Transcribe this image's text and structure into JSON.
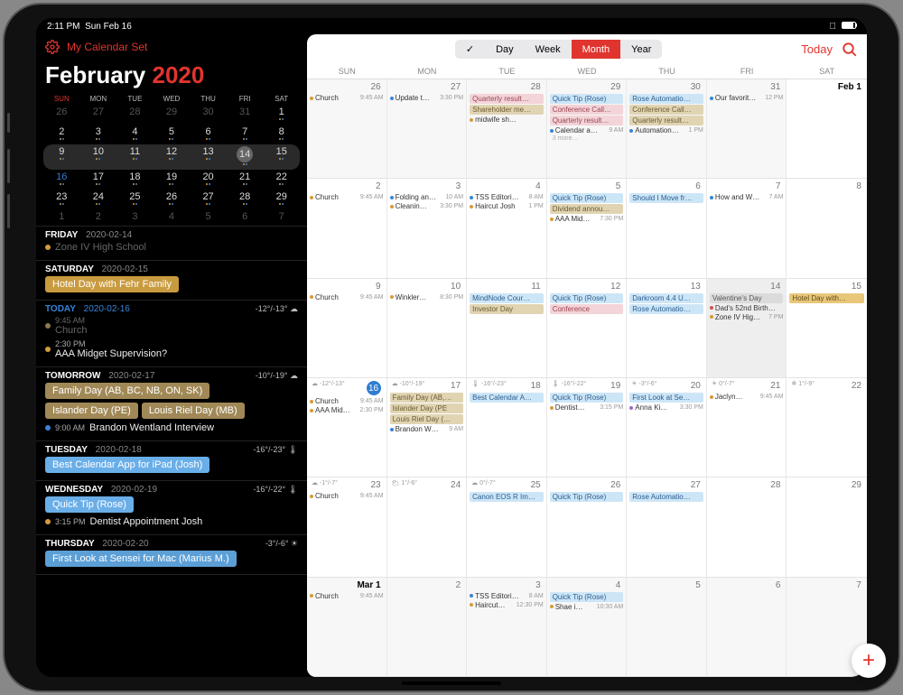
{
  "status": {
    "time": "2:11 PM",
    "date": "Sun Feb 16"
  },
  "sidebar": {
    "calset": "My Calendar Set",
    "month": "February",
    "year": "2020",
    "dow": [
      "SUN",
      "MON",
      "TUE",
      "WED",
      "THU",
      "FRI",
      "SAT"
    ],
    "mini": [
      [
        {
          "n": "26",
          "dim": 1
        },
        {
          "n": "27",
          "dim": 1
        },
        {
          "n": "28",
          "dim": 1
        },
        {
          "n": "29",
          "dim": 1
        },
        {
          "n": "30",
          "dim": 1
        },
        {
          "n": "31",
          "dim": 1
        },
        {
          "n": "1"
        }
      ],
      [
        {
          "n": "2"
        },
        {
          "n": "3"
        },
        {
          "n": "4"
        },
        {
          "n": "5"
        },
        {
          "n": "6"
        },
        {
          "n": "7"
        },
        {
          "n": "8"
        }
      ],
      [
        {
          "n": "9"
        },
        {
          "n": "10"
        },
        {
          "n": "11"
        },
        {
          "n": "12"
        },
        {
          "n": "13"
        },
        {
          "n": "14",
          "ring": 1
        },
        {
          "n": "15"
        }
      ],
      [
        {
          "n": "16",
          "blue": 1
        },
        {
          "n": "17"
        },
        {
          "n": "18"
        },
        {
          "n": "19"
        },
        {
          "n": "20"
        },
        {
          "n": "21"
        },
        {
          "n": "22"
        }
      ],
      [
        {
          "n": "23"
        },
        {
          "n": "24"
        },
        {
          "n": "25"
        },
        {
          "n": "26"
        },
        {
          "n": "27"
        },
        {
          "n": "28"
        },
        {
          "n": "29"
        }
      ],
      [
        {
          "n": "1",
          "dim": 1
        },
        {
          "n": "2",
          "dim": 1
        },
        {
          "n": "3",
          "dim": 1
        },
        {
          "n": "4",
          "dim": 1
        },
        {
          "n": "5",
          "dim": 1
        },
        {
          "n": "6",
          "dim": 1
        },
        {
          "n": "7",
          "dim": 1
        }
      ]
    ],
    "agenda": [
      {
        "hdr": "FRIDAY",
        "date": "2020-02-14",
        "items": [
          {
            "type": "row",
            "dot": "#d49b3d",
            "text": "Zone IV High School",
            "dim": 1
          }
        ]
      },
      {
        "hdr": "SATURDAY",
        "date": "2020-02-15",
        "items": [
          {
            "type": "chip",
            "cls": "gold",
            "text": "Hotel Day with Fehr Family"
          }
        ]
      },
      {
        "hdr": "TODAY",
        "date": "2020-02-16",
        "today": 1,
        "weather": "-12°/-13° ☁",
        "items": [
          {
            "type": "row",
            "dot": "#8b7a4e",
            "time": "9:45 AM",
            "text": "Church",
            "dim": 1
          },
          {
            "type": "row",
            "dot": "#d49b3d",
            "time": "2:30 PM",
            "text": "AAA Midget Supervision?"
          }
        ]
      },
      {
        "hdr": "TOMORROW",
        "date": "2020-02-17",
        "weather": "-10°/-19° ☁",
        "items": [
          {
            "type": "chip",
            "cls": "tan",
            "text": "Family Day (AB, BC, NB, ON, SK)"
          },
          {
            "type": "chips",
            "chips": [
              {
                "cls": "tan",
                "text": "Islander Day (PE)"
              },
              {
                "cls": "tan",
                "text": "Louis Riel Day (MB)"
              }
            ]
          },
          {
            "type": "row",
            "dot": "#3a84d6",
            "time": "9:00 AM",
            "text": "Brandon Wentland Interview"
          }
        ]
      },
      {
        "hdr": "TUESDAY",
        "date": "2020-02-18",
        "weather": "-16°/-23° 🌡",
        "items": [
          {
            "type": "chip",
            "cls": "sky",
            "text": "Best Calendar App for iPad (Josh)"
          }
        ]
      },
      {
        "hdr": "WEDNESDAY",
        "date": "2020-02-19",
        "weather": "-16°/-22° 🌡",
        "items": [
          {
            "type": "chip",
            "cls": "sky",
            "text": "Quick Tip (Rose)"
          },
          {
            "type": "row",
            "dot": "#d49b3d",
            "time": "3:15 PM",
            "text": "Dentist Appointment Josh"
          }
        ]
      },
      {
        "hdr": "THURSDAY",
        "date": "2020-02-20",
        "weather": "-3°/-6° ☀",
        "items": [
          {
            "type": "chip",
            "cls": "lsky",
            "text": "First Look at Sensei for Mac (Marius M.)"
          }
        ]
      }
    ]
  },
  "toolbar": {
    "check": "✓",
    "day": "Day",
    "week": "Week",
    "month": "Month",
    "year": "Year",
    "today": "Today"
  },
  "dow": [
    "SUN",
    "MON",
    "TUE",
    "WED",
    "THU",
    "FRI",
    "SAT"
  ],
  "weeks": [
    [
      {
        "n": "26",
        "pale": 1,
        "evts": [
          {
            "d": "#d49b3d",
            "nm": "Church",
            "tm": "9:45 AM"
          }
        ]
      },
      {
        "n": "27",
        "pale": 1,
        "evts": [
          {
            "d": "#3a84d6",
            "nm": "Update t…",
            "tm": "3:30 PM"
          }
        ]
      },
      {
        "n": "28",
        "pale": 1,
        "bars": [
          {
            "c": "b-pink",
            "t": "Quarterly result…"
          },
          {
            "c": "b-tan",
            "t": "Shareholder me…"
          }
        ],
        "evts": [
          {
            "d": "#d49b3d",
            "nm": "midwife sh…"
          }
        ]
      },
      {
        "n": "29",
        "pale": 1,
        "bars": [
          {
            "c": "b-lblue",
            "t": "Quick Tip (Rose)"
          },
          {
            "c": "b-pink",
            "t": "Conference Call…"
          },
          {
            "c": "b-pink",
            "t": "Quarterly result…"
          }
        ],
        "evts": [
          {
            "d": "#3a84d6",
            "nm": "Calendar a…",
            "tm": "9 AM"
          }
        ],
        "more": "3 more…"
      },
      {
        "n": "30",
        "pale": 1,
        "bars": [
          {
            "c": "b-lblue",
            "t": "Rose Automatio…"
          },
          {
            "c": "b-tan",
            "t": "Conference Call…"
          },
          {
            "c": "b-tan",
            "t": "Quarterly result…"
          }
        ],
        "evts": [
          {
            "d": "#3a84d6",
            "nm": "Automation…",
            "tm": "1 PM"
          }
        ]
      },
      {
        "n": "31",
        "pale": 1,
        "evts": [
          {
            "d": "#3a84d6",
            "nm": "Our favorit…",
            "tm": "12 PM"
          }
        ]
      },
      {
        "n": "Feb 1",
        "mstart": 1
      }
    ],
    [
      {
        "n": "2",
        "evts": [
          {
            "d": "#d49b3d",
            "nm": "Church",
            "tm": "9:45 AM"
          }
        ]
      },
      {
        "n": "3",
        "evts": [
          {
            "d": "#3a84d6",
            "nm": "Folding an…",
            "tm": "10 AM"
          },
          {
            "d": "#d49b3d",
            "nm": "Cleanin…",
            "tm": "3:30 PM"
          }
        ]
      },
      {
        "n": "4",
        "evts": [
          {
            "d": "#3a84d6",
            "nm": "TSS Editori…",
            "tm": "8 AM"
          },
          {
            "d": "#d49b3d",
            "nm": "Haircut Josh",
            "tm": "1 PM"
          }
        ]
      },
      {
        "n": "5",
        "bars": [
          {
            "c": "b-lblue",
            "t": "Quick Tip (Rose)"
          },
          {
            "c": "b-tan",
            "t": "Dividend annou…"
          }
        ],
        "evts": [
          {
            "d": "#d49b3d",
            "nm": "AAA Mid…",
            "tm": "7:30 PM"
          }
        ]
      },
      {
        "n": "6",
        "bars": [
          {
            "c": "b-lblue",
            "t": "Should I Move fr…"
          }
        ]
      },
      {
        "n": "7",
        "evts": [
          {
            "d": "#3a84d6",
            "nm": "How and W…",
            "tm": "7 AM"
          }
        ]
      },
      {
        "n": "8"
      }
    ],
    [
      {
        "n": "9",
        "evts": [
          {
            "d": "#d49b3d",
            "nm": "Church",
            "tm": "9:45 AM"
          }
        ]
      },
      {
        "n": "10",
        "evts": [
          {
            "d": "#d49b3d",
            "nm": "Winkler…",
            "tm": "8:30 PM"
          }
        ]
      },
      {
        "n": "11",
        "bars": [
          {
            "c": "b-lblue",
            "t": "MindNode Cour…"
          },
          {
            "c": "b-tan",
            "t": "Investor Day"
          }
        ]
      },
      {
        "n": "12",
        "bars": [
          {
            "c": "b-lblue",
            "t": "Quick Tip (Rose)"
          },
          {
            "c": "b-pink",
            "t": "Conference"
          }
        ]
      },
      {
        "n": "13",
        "bars": [
          {
            "c": "b-lblue",
            "t": "Darkroom 4.4 U…"
          },
          {
            "c": "b-lblue",
            "t": "Rose Automatio…"
          }
        ]
      },
      {
        "n": "14",
        "grey": 1,
        "bars": [
          {
            "c": "b-grey",
            "t": "Valentine's Day"
          }
        ],
        "evts": [
          {
            "d": "#d15050",
            "nm": "Dad's 52nd Birth…"
          },
          {
            "d": "#d49b3d",
            "nm": "Zone IV Hig…",
            "tm": "7 PM"
          }
        ]
      },
      {
        "n": "15",
        "bars": [
          {
            "c": "b-gold",
            "t": "Hotel Day with…"
          }
        ]
      }
    ],
    [
      {
        "n": "16",
        "today": 1,
        "wx": "☁ -12°/-13°",
        "evts": [
          {
            "d": "#d49b3d",
            "nm": "Church",
            "tm": "9:45 AM"
          },
          {
            "d": "#d49b3d",
            "nm": "AAA Mid…",
            "tm": "2:30 PM"
          }
        ]
      },
      {
        "n": "17",
        "wx": "☁ -10°/-19°",
        "bars": [
          {
            "c": "b-tan",
            "t": "Family Day (AB,…"
          },
          {
            "c": "b-tan",
            "t": "Islander Day (PE"
          },
          {
            "c": "b-tan",
            "t": "Louis Riel Day (…"
          }
        ],
        "evts": [
          {
            "d": "#3a84d6",
            "nm": "Brandon W…",
            "tm": "9 AM"
          }
        ]
      },
      {
        "n": "18",
        "wx": "🌡 -16°/-23°",
        "bars": [
          {
            "c": "b-lblue",
            "t": "Best Calendar A…"
          }
        ]
      },
      {
        "n": "19",
        "wx": "🌡 -16°/-22°",
        "bars": [
          {
            "c": "b-lblue",
            "t": "Quick Tip (Rose)"
          }
        ],
        "evts": [
          {
            "d": "#d49b3d",
            "nm": "Dentist…",
            "tm": "3:15 PM"
          }
        ]
      },
      {
        "n": "20",
        "wx": "☀ -3°/-6°",
        "bars": [
          {
            "c": "b-lblue",
            "t": "First Look at Se…"
          }
        ],
        "evts": [
          {
            "d": "#a06bc0",
            "nm": "Anna Ki…",
            "tm": "3:30 PM"
          }
        ]
      },
      {
        "n": "21",
        "wx": "☀ 0°/-7°",
        "evts": [
          {
            "d": "#d49b3d",
            "nm": "Jaclyn…",
            "tm": "9:45 AM"
          }
        ]
      },
      {
        "n": "22",
        "wx": "❄ 1°/-9°"
      }
    ],
    [
      {
        "n": "23",
        "wx": "☁ -1°/-7°",
        "evts": [
          {
            "d": "#d49b3d",
            "nm": "Church",
            "tm": "9:45 AM"
          }
        ]
      },
      {
        "n": "24",
        "wx": "🌥 1°/-6°"
      },
      {
        "n": "25",
        "wx": "☁ 0°/-7°",
        "bars": [
          {
            "c": "b-lblue",
            "t": "Canon EOS R Im…"
          }
        ]
      },
      {
        "n": "26",
        "bars": [
          {
            "c": "b-lblue",
            "t": "Quick Tip (Rose)"
          }
        ]
      },
      {
        "n": "27",
        "bars": [
          {
            "c": "b-lblue",
            "t": "Rose Automatio…"
          }
        ]
      },
      {
        "n": "28"
      },
      {
        "n": "29"
      }
    ],
    [
      {
        "n": "Mar 1",
        "pale": 1,
        "mstart": 1,
        "evts": [
          {
            "d": "#d49b3d",
            "nm": "Church",
            "tm": "9:45 AM"
          }
        ]
      },
      {
        "n": "2",
        "pale": 1
      },
      {
        "n": "3",
        "pale": 1,
        "evts": [
          {
            "d": "#3a84d6",
            "nm": "TSS Editori…",
            "tm": "8 AM"
          },
          {
            "d": "#d49b3d",
            "nm": "Haircut…",
            "tm": "12:30 PM"
          }
        ]
      },
      {
        "n": "4",
        "pale": 1,
        "bars": [
          {
            "c": "b-lblue",
            "t": "Quick Tip (Rose)"
          }
        ],
        "evts": [
          {
            "d": "#d49b3d",
            "nm": "Shae i…",
            "tm": "10:30 AM"
          }
        ]
      },
      {
        "n": "5",
        "pale": 1
      },
      {
        "n": "6",
        "pale": 1
      },
      {
        "n": "7",
        "pale": 1
      }
    ]
  ]
}
